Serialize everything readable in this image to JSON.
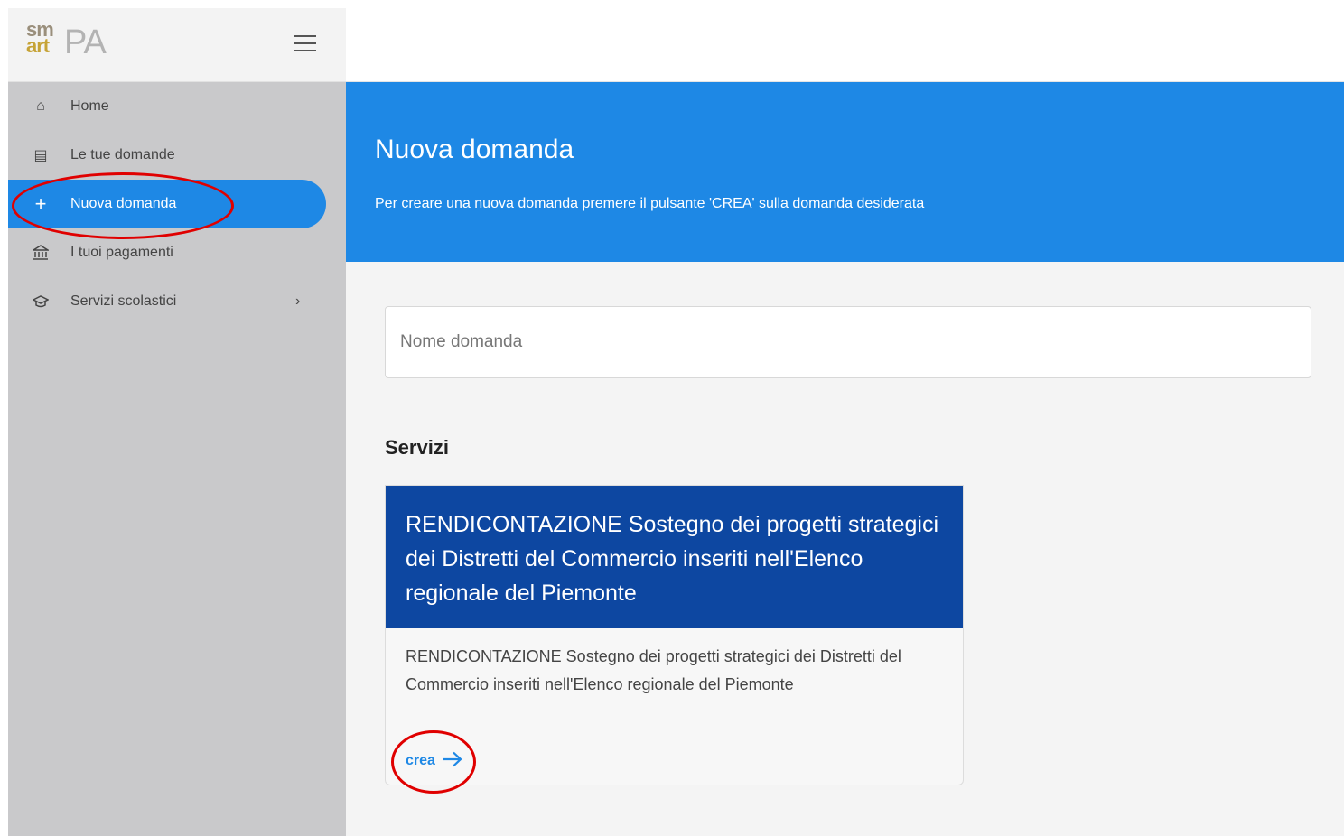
{
  "brand": {
    "logo_sm": "sm",
    "logo_art": "art",
    "logo_pa": "PA"
  },
  "sidebar": {
    "items": [
      {
        "label": "Home",
        "icon": "home-icon",
        "glyph": "⌂",
        "active": false
      },
      {
        "label": "Le tue domande",
        "icon": "clipboard-icon",
        "glyph": "▤",
        "active": false
      },
      {
        "label": "Nuova domanda",
        "icon": "plus-icon",
        "glyph": "+",
        "active": true
      },
      {
        "label": "I tuoi pagamenti",
        "icon": "bank-icon",
        "glyph": "🏛",
        "active": false
      },
      {
        "label": "Servizi scolastici",
        "icon": "graduation-cap-icon",
        "glyph": "◈",
        "active": false,
        "chevron": "›"
      }
    ]
  },
  "hero": {
    "title": "Nuova domanda",
    "subtitle": "Per creare una nuova domanda premere il pulsante 'CREA' sulla domanda desiderata"
  },
  "search": {
    "placeholder": "Nome domanda",
    "value": ""
  },
  "services": {
    "title": "Servizi",
    "cards": [
      {
        "title": "RENDICONTAZIONE Sostegno dei progetti strategici dei Distretti del Commercio inseriti nell'Elenco regionale del Piemonte",
        "description": "RENDICONTAZIONE Sostegno dei progetti strategici dei Distretti del Commercio inseriti nell'Elenco regionale del Piemonte",
        "action_label": "crea",
        "action_icon": "arrow-right-icon"
      }
    ]
  },
  "colors": {
    "primary": "#1e88e5",
    "card_header": "#0d47a1",
    "sidebar_bg": "#c9c9cb",
    "annotation": "#e00000"
  }
}
